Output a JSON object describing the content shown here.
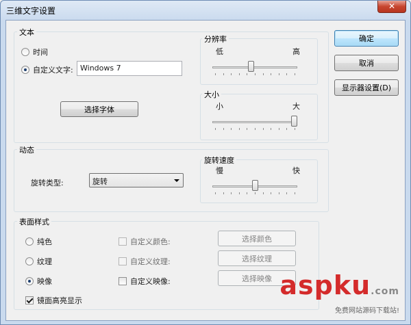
{
  "window": {
    "title": "三维文字设置",
    "close_symbol": "✕"
  },
  "text_group": {
    "label": "文本",
    "time_label": "时间",
    "custom_text_label": "自定义文字:",
    "custom_text_value": "Windows 7",
    "choose_font_label": "选择字体",
    "selected": "custom"
  },
  "resolution_group": {
    "label": "分辨率",
    "low": "低",
    "high": "高",
    "value_percent": 45
  },
  "size_group": {
    "label": "大小",
    "small": "小",
    "large": "大",
    "value_percent": 100
  },
  "motion_group": {
    "label": "动态",
    "rotation_type_label": "旋转类型:",
    "rotation_type_value": "旋转"
  },
  "rotation_speed_group": {
    "label": "旋转速度",
    "slow": "慢",
    "fast": "快",
    "value_percent": 50
  },
  "surface_group": {
    "label": "表面样式",
    "solid_label": "纯色",
    "texture_label": "纹理",
    "reflection_label": "映像",
    "selected": "reflection",
    "custom_color_label": "自定义颜色:",
    "custom_texture_label": "自定义纹理:",
    "custom_reflection_label": "自定义映像:",
    "choose_color_label": "选择颜色",
    "choose_texture_label": "选择纹理",
    "choose_reflection_label": "选择映像",
    "specular_label": "镜面高亮显示",
    "specular_checked": true
  },
  "buttons": {
    "ok": "确定",
    "cancel": "取消",
    "display_settings": "显示器设置(D)"
  },
  "watermark": {
    "brand": "aspku",
    "suffix": ".com",
    "tagline": "免费网站源码下载站!"
  },
  "colors": {
    "accent": "#3c7fb1",
    "watermark_red": "#d42b2b"
  }
}
